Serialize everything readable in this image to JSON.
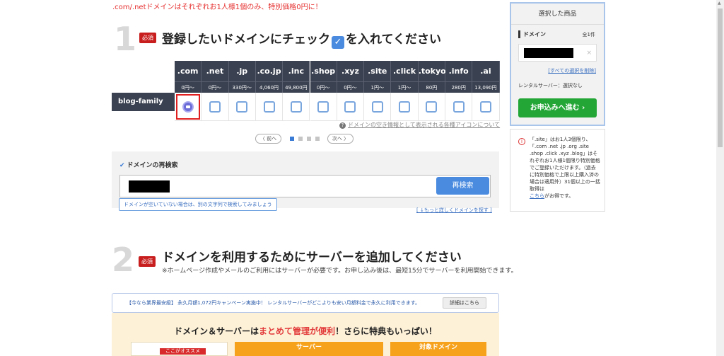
{
  "notice": ".com/.netドメインはそれぞれお1人様1個のみ、特別価格0円に！",
  "step1": {
    "num": "1",
    "badge": "必須",
    "title_pre": "登録したいドメインにチェック",
    "title_post": "を入れてください"
  },
  "table": {
    "domain_name": "blog-family",
    "tlds": [
      ".com",
      ".net",
      ".jp",
      ".co.jp",
      ".inc",
      ".shop",
      ".xyz",
      ".site",
      ".click",
      ".tokyo",
      ".info",
      ".ai"
    ],
    "prices": [
      "0円〜",
      "0円〜",
      "330円〜",
      "4,060円",
      "49,800円",
      "0円〜",
      "0円〜",
      "1円〜",
      "1円〜",
      "80円",
      "280円",
      "13,090円"
    ],
    "checked_index": 0
  },
  "help_link": "ドメインの空き情報として表示される各種アイコンについて",
  "pager": {
    "prev": "〈 前へ",
    "next": "次へ 〉",
    "pages": 4,
    "active": 0
  },
  "research": {
    "title": "ドメインの再検索",
    "button": "再検索",
    "tooltip": "ドメインが空いていない場合は、別の文字列で検索してみましょう"
  },
  "more_link": "[ ↓もっと詳しくドメインを探す ]",
  "step2": {
    "num": "2",
    "badge": "必須",
    "title": "ドメインを利用するためにサーバーを追加してください",
    "sub": "※ホームページ作成やメールのご利用にはサーバーが必要です。お申し込み後は、最短15分でサーバーを利用開始できます。"
  },
  "campaign": {
    "text": "【今なら業界最安級】 永久月額1,072円キャンペーン実施中！ レンタルサーバーがどこよりも安い月額料金で永久に利用できます。",
    "button": "詳細はこちら"
  },
  "promo": {
    "title_pre": "ドメイン＆サーバーは",
    "title_red": "まとめて管理が便利",
    "title_post": "！さらに特典もいっぱい！",
    "ribbon": "ここがオススメ",
    "server_head": "サーバー",
    "domain_head": "対象ドメイン"
  },
  "cart": {
    "header": "選択した商品",
    "label": "ドメイン",
    "count": "全1件",
    "remove": "×",
    "clear_all": "[すべての選択を削除]",
    "server_status": "レンタルサーバー：選択なし",
    "submit": "お申込みへ進む"
  },
  "side_notice": {
    "text_1": "「.site」はお1人3個限り、\n「.com .net .jp .org .site .shop .click .xyz .blog」はそれぞれお1人様1個限り特別価格でご登録いただけます。（過去に特別価格で上限以上購入済の場合は適用外）31個以上の一括取得は\n",
    "link": "こちら",
    "text_2": "がお得です。"
  }
}
